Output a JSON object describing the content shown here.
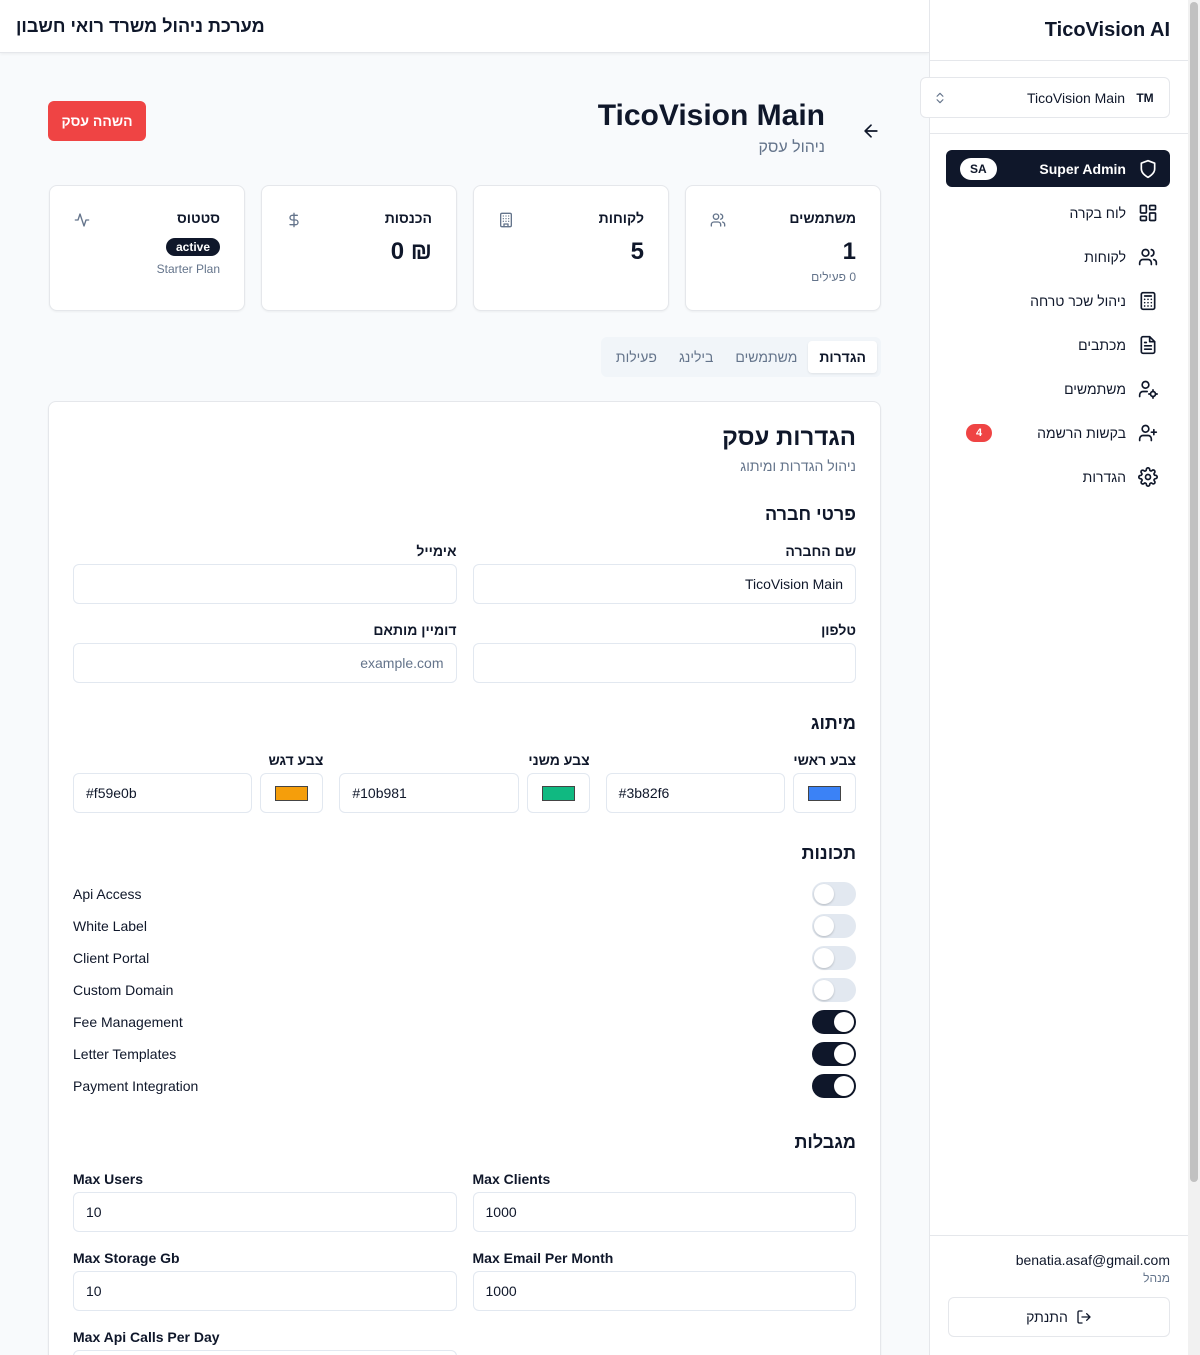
{
  "app": {
    "brand": "TicoVision AI",
    "header_title": "מערכת ניהול משרד רואי חשבון"
  },
  "org_selector": {
    "initials": "TM",
    "name": "TicoVision Main"
  },
  "sidebar": {
    "items": [
      {
        "label": "Super Admin",
        "badge": "SA",
        "icon": "shield-icon"
      },
      {
        "label": "לוח בקרה",
        "icon": "dashboard-icon"
      },
      {
        "label": "לקוחות",
        "icon": "users-icon"
      },
      {
        "label": "ניהול שכר טרחה",
        "icon": "calculator-icon"
      },
      {
        "label": "מכתבים",
        "icon": "file-text-icon"
      },
      {
        "label": "משתמשים",
        "icon": "user-cog-icon"
      },
      {
        "label": "בקשות הרשמה",
        "badge": "4",
        "icon": "user-plus-icon"
      },
      {
        "label": "הגדרות",
        "icon": "gear-icon"
      }
    ],
    "user_email": "benatia.asaf@gmail.com",
    "user_role": "מנהל",
    "logout_label": "התנתק"
  },
  "page": {
    "title": "TicoVision Main",
    "subtitle": "ניהול עסק",
    "suspend_label": "השהה עסק"
  },
  "stats": {
    "users": {
      "title": "משתמשים",
      "value": "1",
      "sub": "0 פעילים"
    },
    "clients": {
      "title": "לקוחות",
      "value": "5"
    },
    "revenue": {
      "title": "הכנסות",
      "value": "₪ 0"
    },
    "status": {
      "title": "סטטוס",
      "badge": "active",
      "plan": "Starter Plan"
    }
  },
  "tabs": [
    "הגדרות",
    "משתמשים",
    "בילינג",
    "פעילות"
  ],
  "settings": {
    "title": "הגדרות עסק",
    "subtitle": "ניהול הגדרות ומיתוג",
    "company_section": "פרטי חברה",
    "company_name_label": "שם החברה",
    "company_name_value": "TicoVision Main",
    "email_label": "אימייל",
    "email_value": "",
    "phone_label": "טלפון",
    "phone_value": "",
    "domain_label": "דומיין מותאם",
    "domain_placeholder": "example.com",
    "branding_section": "מיתוג",
    "primary_label": "צבע ראשי",
    "primary_value": "#3b82f6",
    "secondary_label": "צבע משני",
    "secondary_value": "#10b981",
    "accent_label": "צבע דגש",
    "accent_value": "#f59e0b",
    "features_section": "תכונות",
    "features": [
      {
        "label": "Api Access",
        "enabled": false
      },
      {
        "label": "White Label",
        "enabled": false
      },
      {
        "label": "Client Portal",
        "enabled": false
      },
      {
        "label": "Custom Domain",
        "enabled": false
      },
      {
        "label": "Fee Management",
        "enabled": true
      },
      {
        "label": "Letter Templates",
        "enabled": true
      },
      {
        "label": "Payment Integration",
        "enabled": true
      }
    ],
    "limits_section": "מגבלות",
    "limits": [
      {
        "label": "Max Users",
        "value": "10"
      },
      {
        "label": "Max Clients",
        "value": "1000"
      },
      {
        "label": "Max Storage Gb",
        "value": "10"
      },
      {
        "label": "Max Email Per Month",
        "value": "1000"
      },
      {
        "label": "Max Api Calls Per Day",
        "value": ""
      }
    ]
  },
  "colors": {
    "accent": "#0f172a",
    "danger": "#ef4444"
  }
}
